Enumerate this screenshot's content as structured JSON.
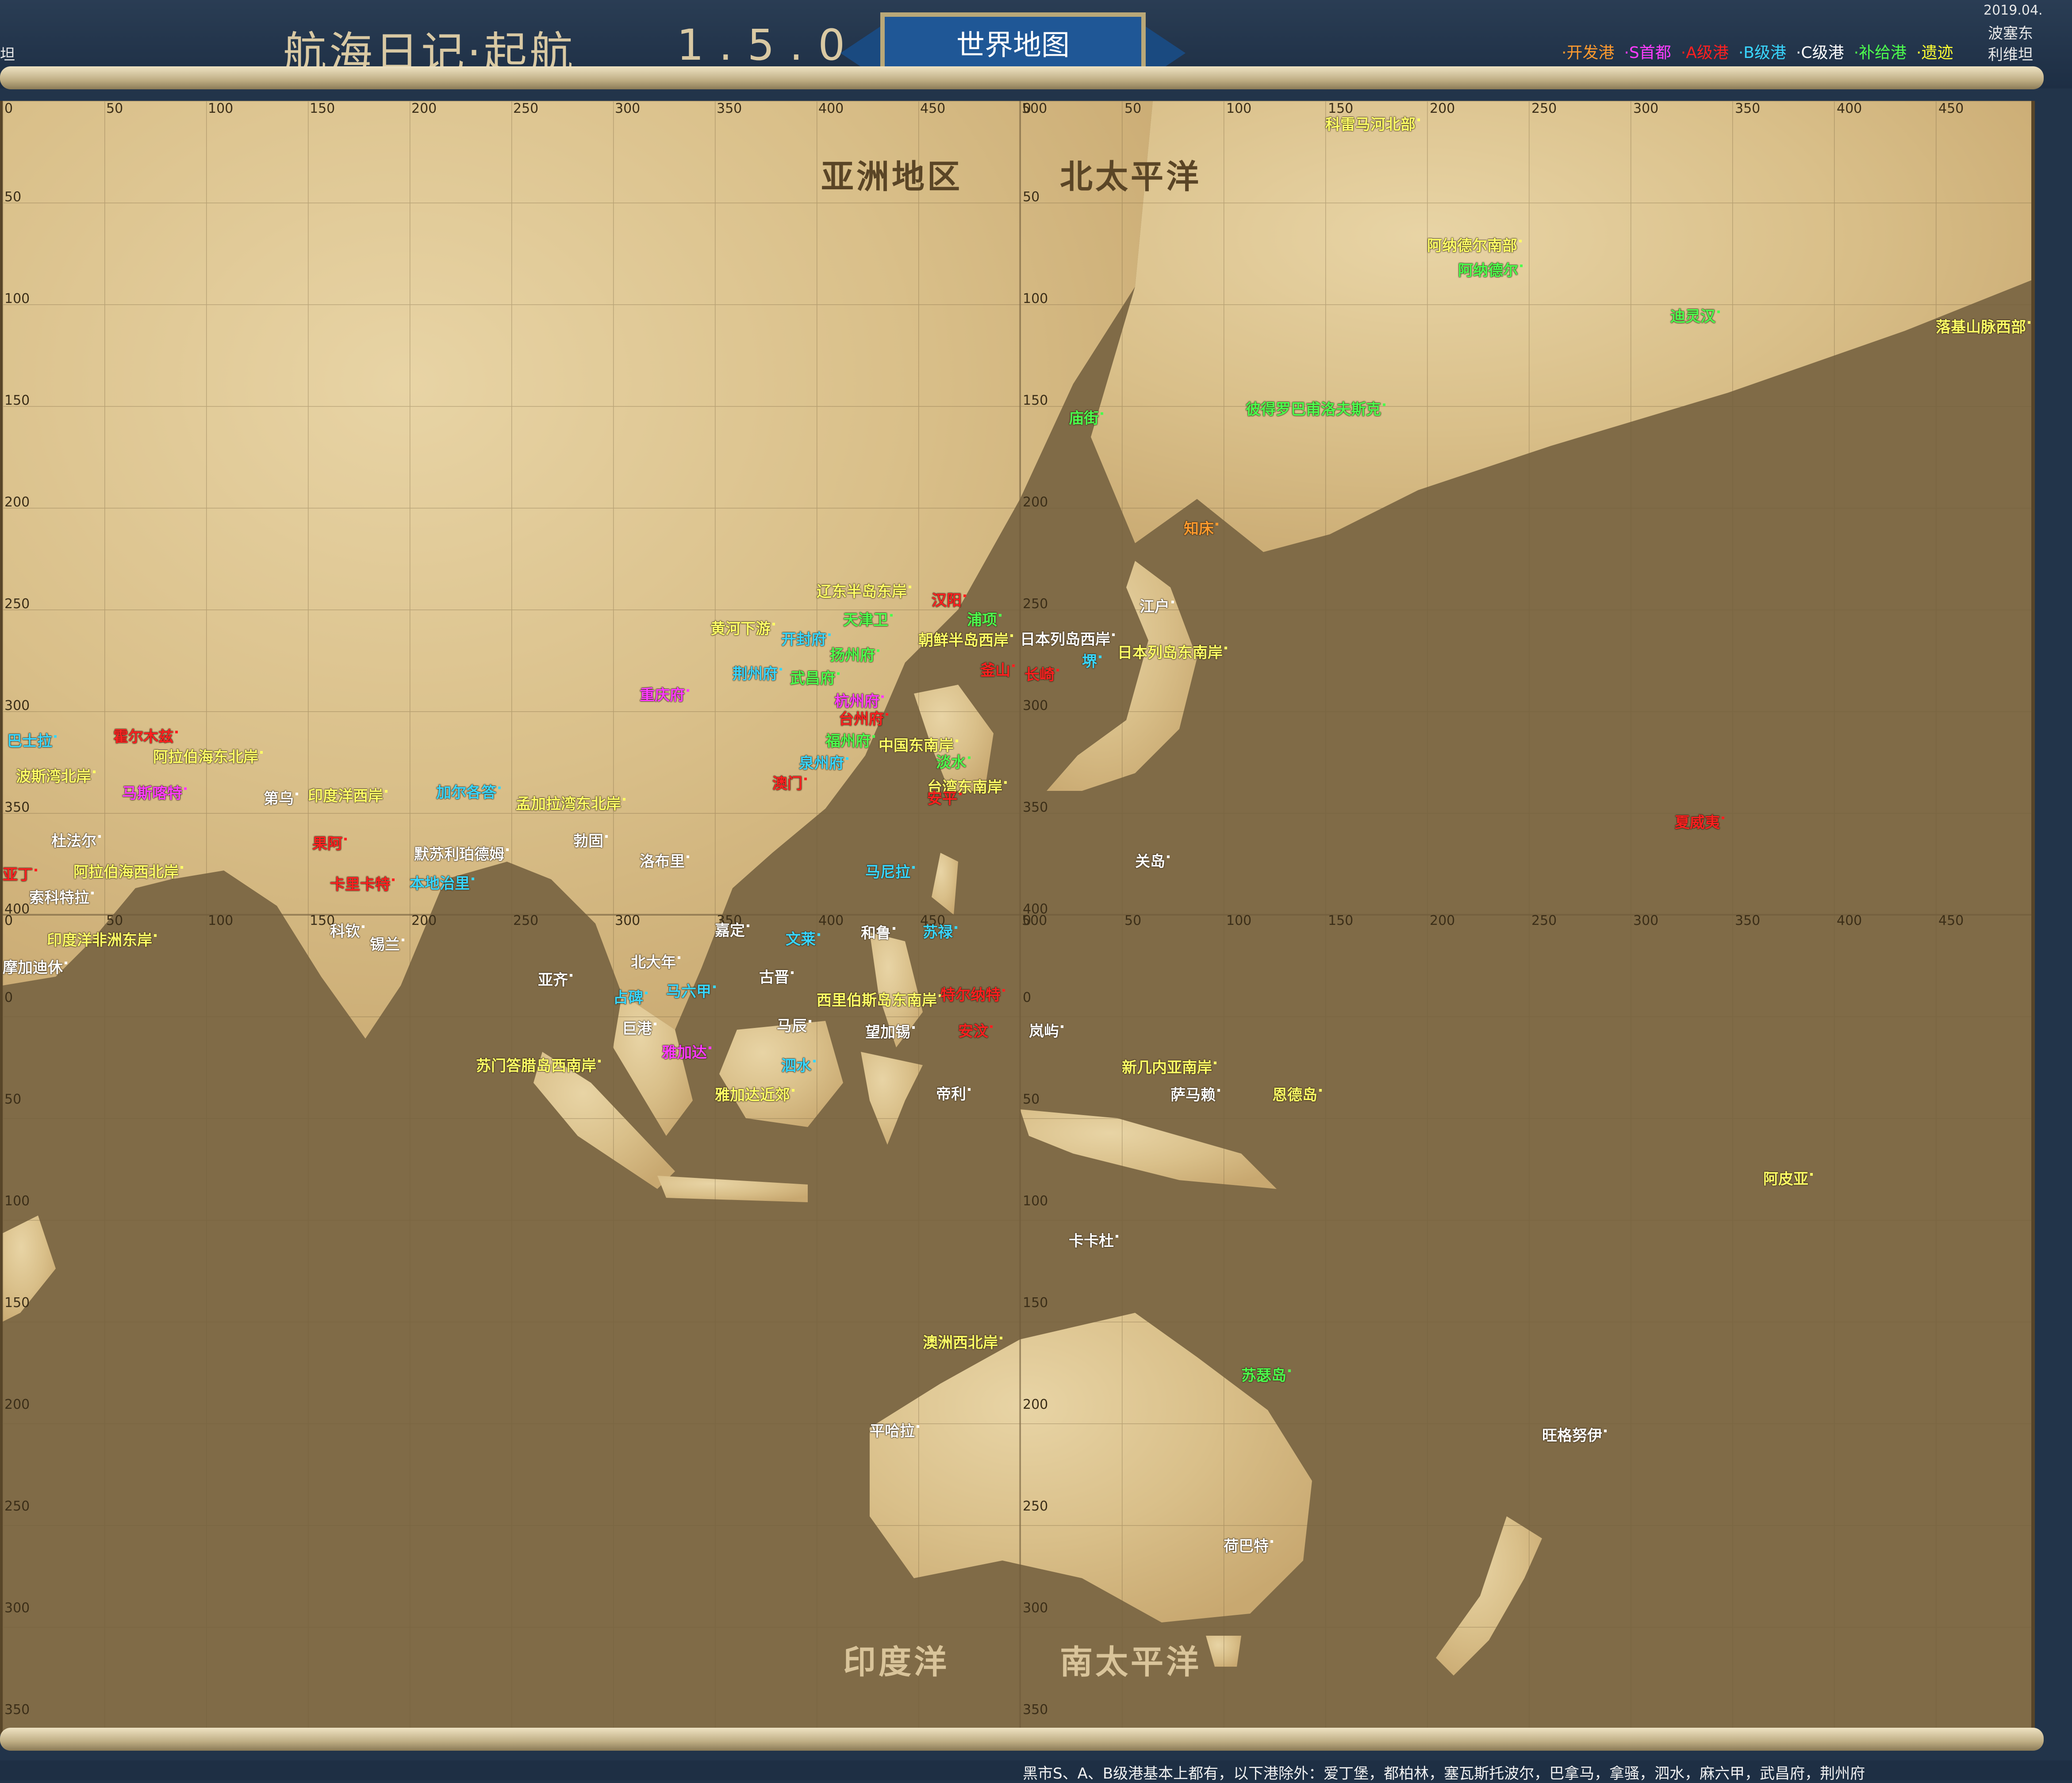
{
  "header": {
    "title": "航海日记·起航",
    "version": "1.5.0",
    "banner": "世界地图",
    "date": "2019.04.",
    "top_right_1": "波塞东",
    "top_right_2": "利维坦",
    "left_cut": "坦"
  },
  "legend": [
    {
      "label": "开发港",
      "color": "#ff9a2e"
    },
    {
      "label": "S首都",
      "color": "#ff3cff"
    },
    {
      "label": "A级港",
      "color": "#ff2020"
    },
    {
      "label": "B级港",
      "color": "#39d6ff"
    },
    {
      "label": "C级港",
      "color": "#ffffff"
    },
    {
      "label": "补给港",
      "color": "#4dff4d"
    },
    {
      "label": "遗迹",
      "color": "#ffff33"
    }
  ],
  "regions": {
    "asia": "亚洲地区",
    "north_pacific": "北太平洋",
    "indian_ocean": "印度洋",
    "south_pacific": "南太平洋"
  },
  "axes": {
    "top_ticks_left": [
      "0",
      "50",
      "100",
      "150",
      "200",
      "250",
      "300",
      "350",
      "400",
      "450",
      "500"
    ],
    "top_ticks_right": [
      "0",
      "50",
      "100",
      "150",
      "200",
      "250",
      "300",
      "350",
      "400",
      "450",
      "500"
    ],
    "left_ticks_top": [
      "50",
      "100",
      "150",
      "200",
      "250",
      "300",
      "350",
      "400"
    ],
    "left_ticks_bottom": [
      "0",
      "50",
      "100",
      "150",
      "200",
      "250",
      "300",
      "350",
      "400"
    ]
  },
  "ports": [
    {
      "name": "科雷马河北部",
      "color": "#ffff66"
    },
    {
      "name": "阿纳德尔南部",
      "color": "#ffff66"
    },
    {
      "name": "阿纳德尔",
      "color": "#4dff4d"
    },
    {
      "name": "迪灵汉",
      "color": "#4dff4d"
    },
    {
      "name": "落基山脉西部",
      "color": "#ffff66"
    },
    {
      "name": "彼得罗巴甫洛夫斯克",
      "color": "#4dff4d"
    },
    {
      "name": "庙街",
      "color": "#4dff4d"
    },
    {
      "name": "知床",
      "color": "#ff9a2e"
    },
    {
      "name": "江户",
      "color": "#ffffff"
    },
    {
      "name": "日本列岛西岸",
      "color": "#ffffff"
    },
    {
      "name": "日本列岛东南岸",
      "color": "#ffff66"
    },
    {
      "name": "堺",
      "color": "#39d6ff"
    },
    {
      "name": "长崎",
      "color": "#ff2020"
    },
    {
      "name": "辽东半岛东岸",
      "color": "#ffff66"
    },
    {
      "name": "汉阳",
      "color": "#ff2020"
    },
    {
      "name": "浦项",
      "color": "#4dff4d"
    },
    {
      "name": "朝鲜半岛西岸",
      "color": "#ffff66"
    },
    {
      "name": "釜山",
      "color": "#ff2020"
    },
    {
      "name": "天津卫",
      "color": "#4dff4d"
    },
    {
      "name": "黄河下游",
      "color": "#ffff66"
    },
    {
      "name": "开封府",
      "color": "#39d6ff"
    },
    {
      "name": "扬州府",
      "color": "#4dff4d"
    },
    {
      "name": "荆州府",
      "color": "#39d6ff"
    },
    {
      "name": "武昌府",
      "color": "#4dff4d"
    },
    {
      "name": "重庆府",
      "color": "#ff3cff"
    },
    {
      "name": "杭州府",
      "color": "#ff3cff"
    },
    {
      "name": "台州府",
      "color": "#ff2020"
    },
    {
      "name": "福州府",
      "color": "#4dff4d"
    },
    {
      "name": "中国东南岸",
      "color": "#ffff66"
    },
    {
      "name": "泉州府",
      "color": "#39d6ff"
    },
    {
      "name": "淡水",
      "color": "#4dff4d"
    },
    {
      "name": "澳门",
      "color": "#ff2020"
    },
    {
      "name": "台湾东南岸",
      "color": "#ffff66"
    },
    {
      "name": "安平",
      "color": "#ff2020"
    },
    {
      "name": "巴士拉",
      "color": "#39d6ff"
    },
    {
      "name": "霍尔木兹",
      "color": "#ff2020"
    },
    {
      "name": "阿拉伯海东北岸",
      "color": "#ffff66"
    },
    {
      "name": "波斯湾北岸",
      "color": "#ffff66"
    },
    {
      "name": "马斯喀特",
      "color": "#ff3cff"
    },
    {
      "name": "第乌",
      "color": "#ffffff"
    },
    {
      "name": "印度洋西岸",
      "color": "#ffff66"
    },
    {
      "name": "加尔各答",
      "color": "#39d6ff"
    },
    {
      "name": "孟加拉湾东北岸",
      "color": "#ffff66"
    },
    {
      "name": "杜法尔",
      "color": "#ffffff"
    },
    {
      "name": "果阿",
      "color": "#ff2020"
    },
    {
      "name": "默苏利珀德姆",
      "color": "#ffffff"
    },
    {
      "name": "勃固",
      "color": "#ffffff"
    },
    {
      "name": "洛布里",
      "color": "#ffffff"
    },
    {
      "name": "亚丁",
      "color": "#ff2020"
    },
    {
      "name": "阿拉伯海西北岸",
      "color": "#ffff66"
    },
    {
      "name": "卡里卡特",
      "color": "#ff2020"
    },
    {
      "name": "本地治里",
      "color": "#39d6ff"
    },
    {
      "name": "索科特拉",
      "color": "#ffffff"
    },
    {
      "name": "马尼拉",
      "color": "#39d6ff"
    },
    {
      "name": "关岛",
      "color": "#ffffff"
    },
    {
      "name": "夏威夷",
      "color": "#ff2020"
    },
    {
      "name": "科钦",
      "color": "#ffffff"
    },
    {
      "name": "锡兰",
      "color": "#ffffff"
    },
    {
      "name": "印度洋非洲东岸",
      "color": "#ffff66"
    },
    {
      "name": "摩加迪休",
      "color": "#ffffff"
    },
    {
      "name": "嘉定",
      "color": "#ffffff"
    },
    {
      "name": "文莱",
      "color": "#39d6ff"
    },
    {
      "name": "和鲁",
      "color": "#ffffff"
    },
    {
      "name": "苏禄",
      "color": "#39d6ff"
    },
    {
      "name": "北大年",
      "color": "#ffffff"
    },
    {
      "name": "亚齐",
      "color": "#ffffff"
    },
    {
      "name": "古晋",
      "color": "#ffffff"
    },
    {
      "name": "占碑",
      "color": "#39d6ff"
    },
    {
      "name": "马六甲",
      "color": "#39d6ff"
    },
    {
      "name": "西里伯斯岛东南岸",
      "color": "#ffff66"
    },
    {
      "name": "特尔纳特",
      "color": "#ff2020"
    },
    {
      "name": "巨港",
      "color": "#ffffff"
    },
    {
      "name": "马辰",
      "color": "#ffffff"
    },
    {
      "name": "望加锡",
      "color": "#ffffff"
    },
    {
      "name": "安汶",
      "color": "#ff2020"
    },
    {
      "name": "岚屿",
      "color": "#ffffff"
    },
    {
      "name": "苏门答腊岛西南岸",
      "color": "#ffff66"
    },
    {
      "name": "雅加达",
      "color": "#ff3cff"
    },
    {
      "name": "泗水",
      "color": "#39d6ff"
    },
    {
      "name": "雅加达近郊",
      "color": "#ffff66"
    },
    {
      "name": "帝利",
      "color": "#ffffff"
    },
    {
      "name": "新几内亚南岸",
      "color": "#ffff66"
    },
    {
      "name": "萨马赖",
      "color": "#ffffff"
    },
    {
      "name": "恩德岛",
      "color": "#ffff66"
    },
    {
      "name": "阿皮亚",
      "color": "#ffff66"
    },
    {
      "name": "卡卡杜",
      "color": "#ffffff"
    },
    {
      "name": "澳洲西北岸",
      "color": "#ffff66"
    },
    {
      "name": "苏瑟岛",
      "color": "#4dff4d"
    },
    {
      "name": "平哈拉",
      "color": "#ffffff"
    },
    {
      "name": "旺格努伊",
      "color": "#ffffff"
    },
    {
      "name": "荷巴特",
      "color": "#ffffff"
    }
  ],
  "footer": {
    "note": "黑市S、A、B级港基本上都有，以下港除外：爱丁堡，都柏林，塞瓦斯托波尔，巴拿马，拿骚，泗水，麻六甲，武昌府，荆州府"
  }
}
